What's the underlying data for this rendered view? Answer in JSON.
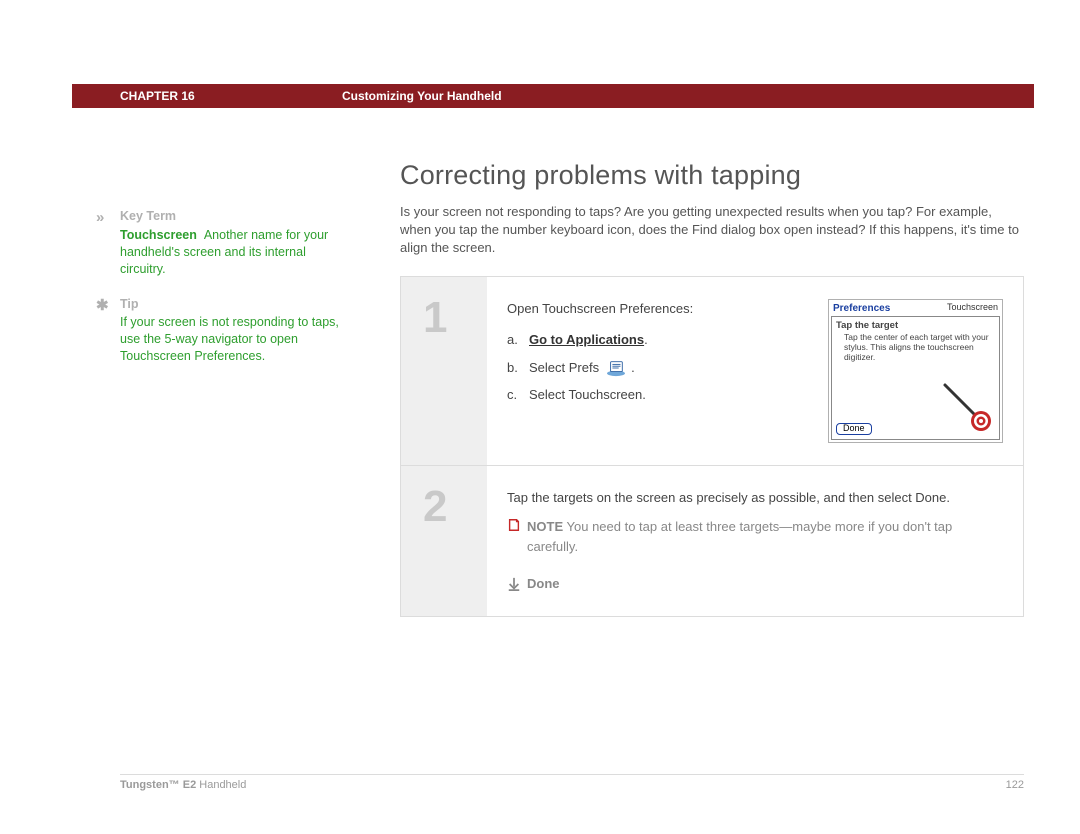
{
  "header": {
    "chapter": "CHAPTER 16",
    "title": "Customizing Your Handheld"
  },
  "sidebar": {
    "key_term": {
      "label": "Key Term",
      "term": "Touchscreen",
      "definition": "Another name for your handheld's screen and its internal circuitry."
    },
    "tip": {
      "label": "Tip",
      "text": "If your screen is not responding to taps, use the 5-way navigator to open Touchscreen Preferences."
    }
  },
  "page": {
    "title": "Correcting problems with tapping",
    "intro": "Is your screen not responding to taps? Are you getting unexpected results when you tap? For example, when you tap the number keyboard icon, does the Find dialog box open instead? If this happens, it's time to align the screen."
  },
  "steps": [
    {
      "num": "1",
      "lead": "Open Touchscreen Preferences:",
      "items": {
        "a_letter": "a.",
        "a_text": "Go to Applications",
        "a_suffix": ".",
        "b_letter": "b.",
        "b_text": "Select Prefs",
        "b_suffix": ".",
        "c_letter": "c.",
        "c_text": "Select Touchscreen."
      },
      "screenshot": {
        "pref": "Preferences",
        "cat": "Touchscreen",
        "heading": "Tap the target",
        "body": "Tap the center of each target with your stylus. This aligns the touchscreen digitizer.",
        "done": "Done"
      }
    },
    {
      "num": "2",
      "text": "Tap the targets on the screen as precisely as possible, and then select Done.",
      "note_label": "NOTE",
      "note_text": "You need to tap at least three targets—maybe more if you don't tap carefully.",
      "done_label": "Done"
    }
  ],
  "footer": {
    "product_bold": "Tungsten™ E2",
    "product_rest": " Handheld",
    "page": "122"
  }
}
